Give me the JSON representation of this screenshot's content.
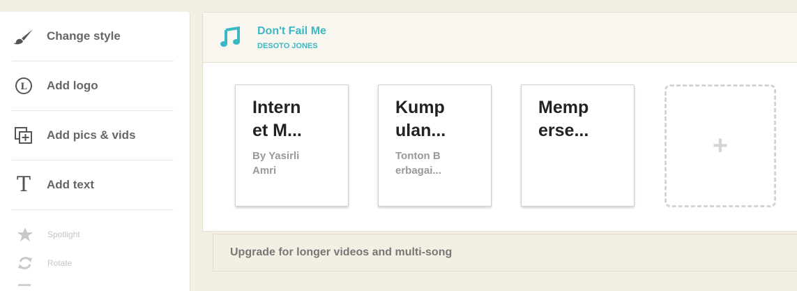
{
  "sidebar": {
    "items": [
      {
        "label": "Change style",
        "icon": "paintbrush-icon"
      },
      {
        "label": "Add logo",
        "icon": "logo-circle-icon"
      },
      {
        "label": "Add pics & vids",
        "icon": "add-media-icon"
      },
      {
        "label": "Add text",
        "icon": "text-t-icon"
      }
    ],
    "small_items": [
      {
        "label": "Spotlight",
        "icon": "star-icon"
      },
      {
        "label": "Rotate",
        "icon": "rotate-icon"
      }
    ]
  },
  "song": {
    "title": "Don't Fail Me",
    "artist": "DESOTO JONES",
    "icon": "music-note-icon",
    "accent_color": "#3bb8c4"
  },
  "cards": [
    {
      "title": "Intern\net M...",
      "subtitle": "By Yasirli\nAmri"
    },
    {
      "title": "Kump\nulan...",
      "subtitle": "Tonton B\nerbagai..."
    },
    {
      "title": "Memp\nerse...",
      "subtitle": ""
    }
  ],
  "add_card": {
    "label": "+"
  },
  "upgrade": {
    "label": "Upgrade for longer videos and multi-song"
  }
}
